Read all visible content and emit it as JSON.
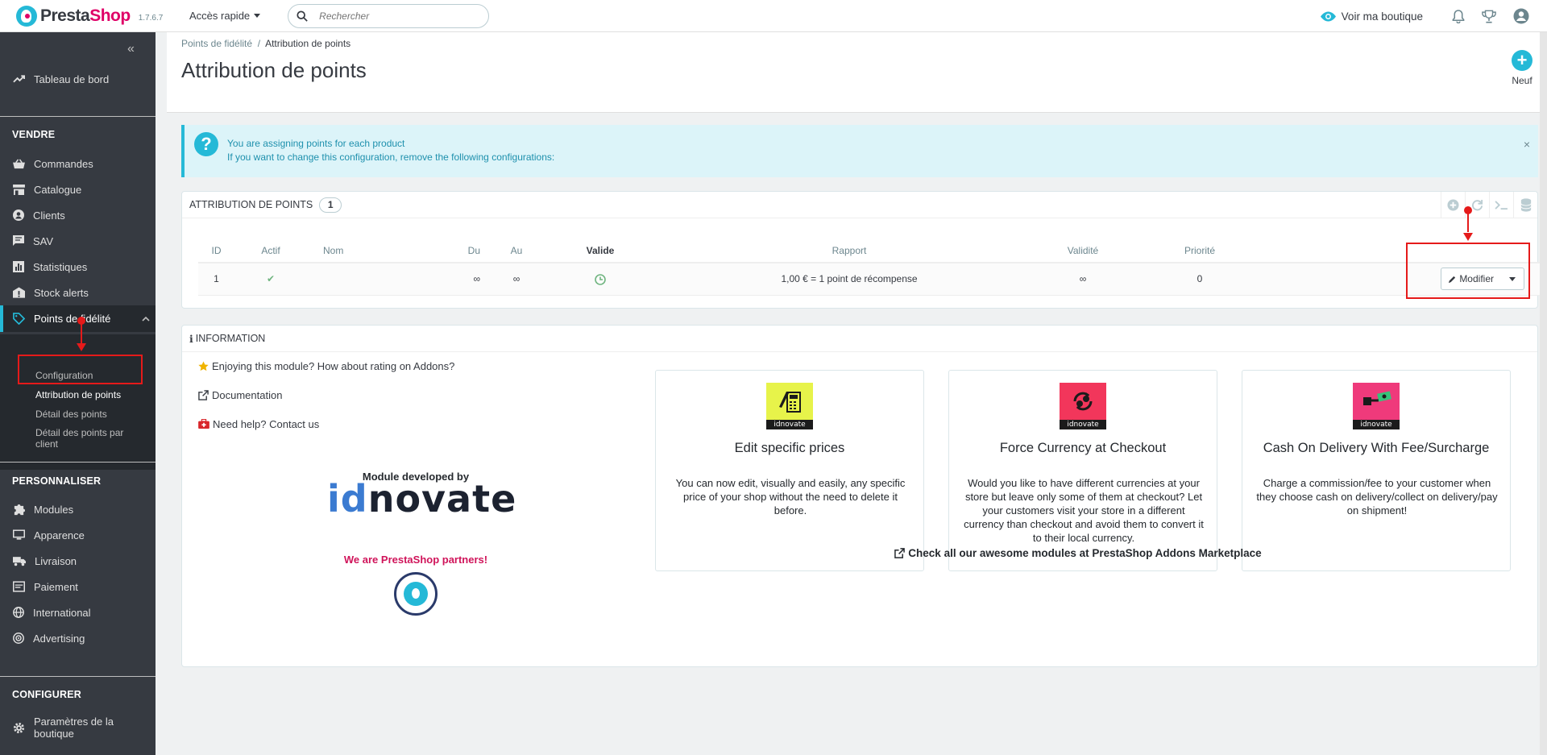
{
  "header": {
    "logo_prefix": "Presta",
    "logo_suffix": "Shop",
    "version": "1.7.6.7",
    "quick_access": "Accès rapide",
    "search_placeholder": "Rechercher",
    "view_shop": "Voir ma boutique"
  },
  "sidebar": {
    "collapse": "«",
    "dashboard": "Tableau de bord",
    "sections": {
      "sell": "VENDRE",
      "customize": "PERSONNALISER",
      "configure": "CONFIGURER"
    },
    "sell_items": [
      "Commandes",
      "Catalogue",
      "Clients",
      "SAV",
      "Statistiques",
      "Stock alerts",
      "Points de fidélité"
    ],
    "sub_items": [
      "Configuration",
      "Attribution de points",
      "Détail des points",
      "Détail des points par client"
    ],
    "customize_items": [
      "Modules",
      "Apparence",
      "Livraison",
      "Paiement",
      "International",
      "Advertising"
    ],
    "configure_items": [
      "Paramètres de la boutique"
    ]
  },
  "page": {
    "breadcrumb_parent": "Points de fidélité",
    "breadcrumb_sep": "/",
    "breadcrumb_current": "Attribution de points",
    "title": "Attribution de points",
    "new_label": "Neuf"
  },
  "alert": {
    "icon": "?",
    "line1": "You are assigning points for each product",
    "line2": "If you want to change this configuration, remove the following configurations:",
    "close": "×"
  },
  "list_panel": {
    "title": "Attribution de points",
    "count": "1",
    "columns": [
      "ID",
      "Actif",
      "Nom",
      "Du",
      "Au",
      "Valide",
      "Rapport",
      "Validité",
      "Priorité"
    ],
    "row": {
      "id": "1",
      "active": "✔",
      "name": "",
      "from": "∞",
      "to": "∞",
      "valid": "valid-clock-icon",
      "ratio": "1,00 € = 1 point de récompense",
      "validity": "∞",
      "priority": "0"
    },
    "modify_label": "Modifier"
  },
  "info_panel": {
    "title": "INFORMATION",
    "rate_link": "Enjoying this module? How about rating on Addons?",
    "doc_link": "Documentation",
    "help_link": "Need help? Contact us",
    "developed_by": "Module developed by",
    "logo_id": "id",
    "logo_rest": "novate",
    "partners": "We are PrestaShop partners!",
    "marketplace_link": "Check all our awesome modules at PrestaShop Addons Marketplace",
    "cards": [
      {
        "title": "Edit specific prices",
        "brand": "idnovate",
        "color": "#e7f34a",
        "description": "You can now edit, visually and easily, any specific price of your shop without the need to delete it before."
      },
      {
        "title": "Force Currency at Checkout",
        "brand": "idnovate",
        "color": "#f2365b",
        "description": "Would you like to have different currencies at your store but leave only some of them at checkout? Let your customers visit your store in a different currency than checkout and avoid them to convert it to their local currency."
      },
      {
        "title": "Cash On Delivery With Fee/Surcharge",
        "brand": "idnovate",
        "color": "#ef3a7b",
        "description": "Charge a commission/fee to your customer when they choose cash on delivery/collect on delivery/pay on shipment!"
      }
    ]
  },
  "colors": {
    "accent": "#25b9d7",
    "sidebar_bg": "#363a41",
    "annotation_red": "#e51a1a",
    "brand_pink": "#df0067"
  }
}
